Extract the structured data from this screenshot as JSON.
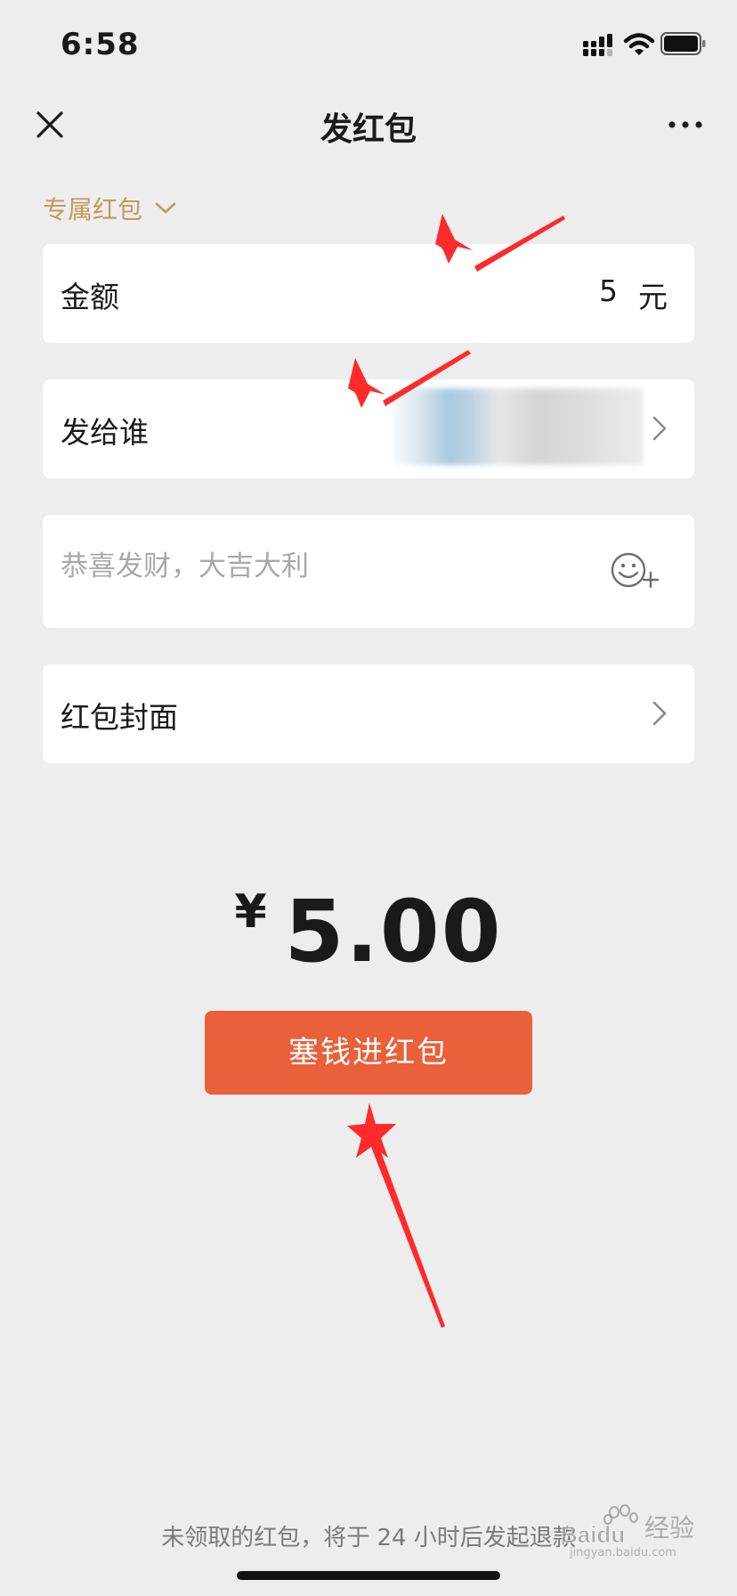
{
  "status_bar": {
    "time": "6:58"
  },
  "nav": {
    "title": "发红包",
    "close_icon": "close-icon",
    "more_icon": "more-icon"
  },
  "packet_type": {
    "label": "专属红包",
    "icon": "chevron-down-icon"
  },
  "amount": {
    "label": "金额",
    "value": "5",
    "unit": "元"
  },
  "recipient": {
    "label": "发给谁",
    "icon": "chevron-right-icon"
  },
  "greeting": {
    "placeholder": "恭喜发财，大吉大利",
    "icon": "emoji-add-icon"
  },
  "cover": {
    "label": "红包封面",
    "icon": "chevron-right-icon"
  },
  "total": {
    "currency": "¥",
    "value": "5.00"
  },
  "submit": {
    "label": "塞钱进红包"
  },
  "notice": {
    "text": "未领取的红包，将于 24 小时后发起退款"
  },
  "watermark": {
    "brand": "Baidu",
    "label": "经验",
    "sub": "jingyan.baidu.com"
  },
  "colors": {
    "accent_gold": "#c29a59",
    "submit_orange": "#e9603a",
    "background": "#ededed",
    "annotation_red": "#ff2a2a"
  }
}
